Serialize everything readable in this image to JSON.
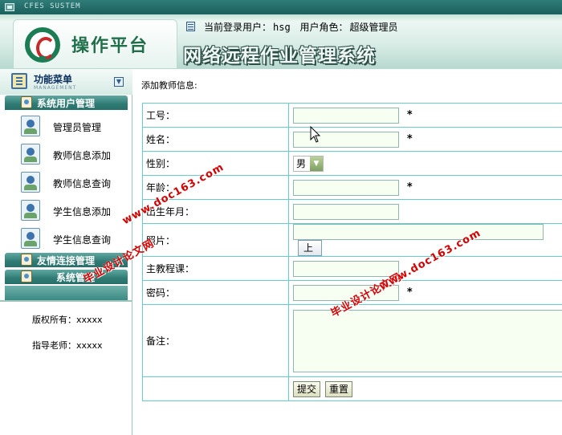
{
  "titlebar": {
    "system_name": "CFES SUSTEM"
  },
  "header": {
    "logo_text": "操作平台",
    "current_user_label": "当前登录用户：",
    "current_user_value": "hsg",
    "role_label": "用户角色：",
    "role_value": "超级管理员",
    "system_title": "网络远程作业管理系统"
  },
  "sidebar": {
    "menu_title": "功能菜单",
    "menu_subtitle": "MANAGEMENT",
    "groups": [
      {
        "label": "系统用户管理"
      },
      {
        "label": "友情连接管理"
      },
      {
        "label": "系统管理"
      }
    ],
    "items": [
      {
        "label": "管理员管理"
      },
      {
        "label": "教师信息添加"
      },
      {
        "label": "教师信息查询"
      },
      {
        "label": "学生信息添加"
      },
      {
        "label": "学生信息查询"
      }
    ],
    "copyright": "版权所有：xxxxx",
    "advisor": "指导老师：xxxxx"
  },
  "main": {
    "heading": "添加教师信息:",
    "fields": {
      "id_label": "工号：",
      "name_label": "姓名：",
      "gender_label": "性别：",
      "gender_value": "男",
      "age_label": "年龄：",
      "birth_label": "出生年月：",
      "photo_label": "照片：",
      "upload_label": "上",
      "course_label": "主教程课：",
      "password_label": "密码：",
      "remark_label": "备注：",
      "required_mark": "*"
    },
    "buttons": {
      "submit": "提交",
      "reset": "重置"
    }
  },
  "watermark": {
    "url": "www.doc163.com",
    "site": "毕业设计论文网"
  }
}
